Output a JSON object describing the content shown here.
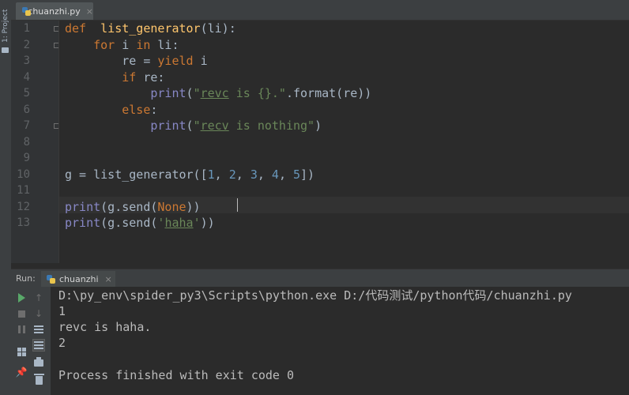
{
  "tool_window": {
    "project_label": "1: Project"
  },
  "editor_tab": {
    "filename": "chuanzhi.py",
    "close": "×"
  },
  "editor": {
    "line_numbers": [
      "1",
      "2",
      "3",
      "4",
      "5",
      "6",
      "7",
      "8",
      "9",
      "10",
      "11",
      "12",
      "13"
    ],
    "lines": [
      [
        [
          "kw",
          "def"
        ],
        [
          "",
          "  "
        ],
        [
          "fn",
          "list_generator"
        ],
        [
          "",
          "(li):"
        ]
      ],
      [
        [
          "",
          "    "
        ],
        [
          "kw",
          "for"
        ],
        [
          "",
          " i "
        ],
        [
          "kw",
          "in"
        ],
        [
          "",
          " li:"
        ]
      ],
      [
        [
          "",
          "        re = "
        ],
        [
          "kw",
          "yield"
        ],
        [
          "",
          " i"
        ]
      ],
      [
        [
          "",
          "        "
        ],
        [
          "kw",
          "if"
        ],
        [
          "",
          " re:"
        ]
      ],
      [
        [
          "",
          "            "
        ],
        [
          "bi",
          "print"
        ],
        [
          "",
          "("
        ],
        [
          "str",
          "\""
        ],
        [
          "str under",
          "revc"
        ],
        [
          "str",
          " is {}.\""
        ],
        [
          "",
          ".format(re))"
        ]
      ],
      [
        [
          "",
          "        "
        ],
        [
          "kw",
          "else"
        ],
        [
          "",
          ":"
        ]
      ],
      [
        [
          "",
          "            "
        ],
        [
          "bi",
          "print"
        ],
        [
          "",
          "("
        ],
        [
          "str",
          "\""
        ],
        [
          "str under",
          "recv"
        ],
        [
          "str",
          " is nothing\""
        ],
        [
          "",
          ")"
        ]
      ],
      [],
      [],
      [
        [
          "",
          "g = list_generator(["
        ],
        [
          "num",
          "1"
        ],
        [
          "",
          ", "
        ],
        [
          "num",
          "2"
        ],
        [
          "",
          ", "
        ],
        [
          "num",
          "3"
        ],
        [
          "",
          ", "
        ],
        [
          "num",
          "4"
        ],
        [
          "",
          ", "
        ],
        [
          "num",
          "5"
        ],
        [
          "",
          "])"
        ]
      ],
      [],
      [
        [
          "bi",
          "print"
        ],
        [
          "",
          "(g.send("
        ],
        [
          "kw",
          "None"
        ],
        [
          "",
          "))"
        ]
      ],
      [
        [
          "bi",
          "print"
        ],
        [
          "",
          "(g.send("
        ],
        [
          "str",
          "'"
        ],
        [
          "str under",
          "haha"
        ],
        [
          "str",
          "'"
        ],
        [
          "",
          "))"
        ]
      ]
    ]
  },
  "run_panel": {
    "label": "Run:",
    "tab": "chuanzhi",
    "close": "×",
    "output": [
      "D:\\py_env\\spider_py3\\Scripts\\python.exe D:/代码测试/python代码/chuanzhi.py",
      "1",
      "revc is haha.",
      "2",
      "",
      "Process finished with exit code 0"
    ]
  },
  "colors": {
    "background": "#2b2b2b",
    "keyword": "#cc7832",
    "function": "#ffc66d",
    "string": "#6a8759",
    "number": "#6897bb",
    "builtin": "#8888c6"
  }
}
